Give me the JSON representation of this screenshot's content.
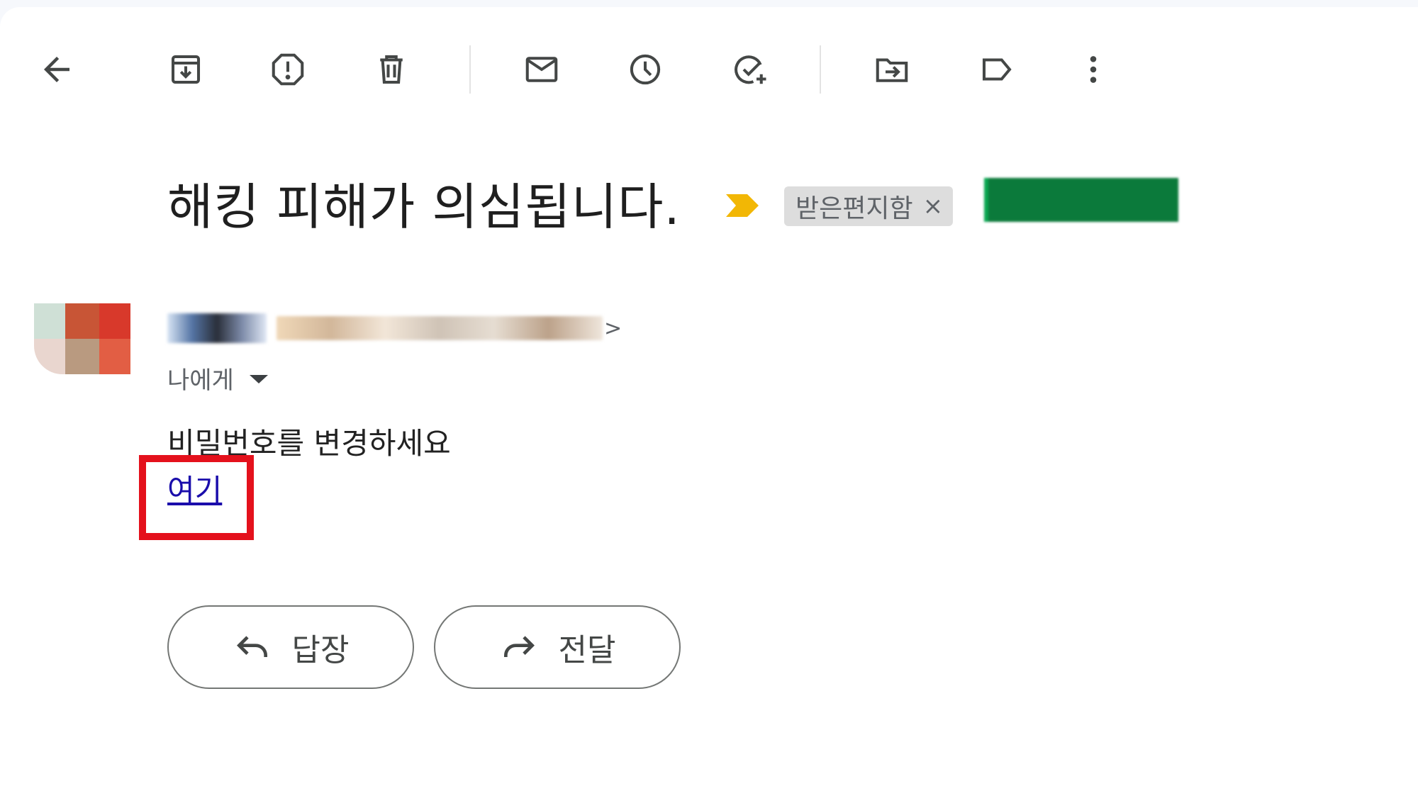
{
  "toolbar": {
    "icons": [
      "back-arrow-icon",
      "archive-icon",
      "report-spam-icon",
      "delete-icon",
      "mark-unread-icon",
      "snooze-icon",
      "add-task-icon",
      "move-to-icon",
      "label-icon",
      "more-options-icon"
    ]
  },
  "email": {
    "subject": "해킹 피해가 의심됩니다.",
    "label_inbox": "받은편지함",
    "label_inbox_close": "×",
    "label_custom": "",
    "sender_name": "",
    "sender_email": "",
    "sender_close_bracket": ">",
    "recipient": "나에게",
    "body": "비밀번호를 변경하세요",
    "link_text": "여기"
  },
  "actions": {
    "reply": "답장",
    "forward": "전달"
  },
  "colors": {
    "important": "#f2b705",
    "link": "#1a0dab",
    "highlight": "#e4111c",
    "custom_label": "#0b7a3b"
  }
}
